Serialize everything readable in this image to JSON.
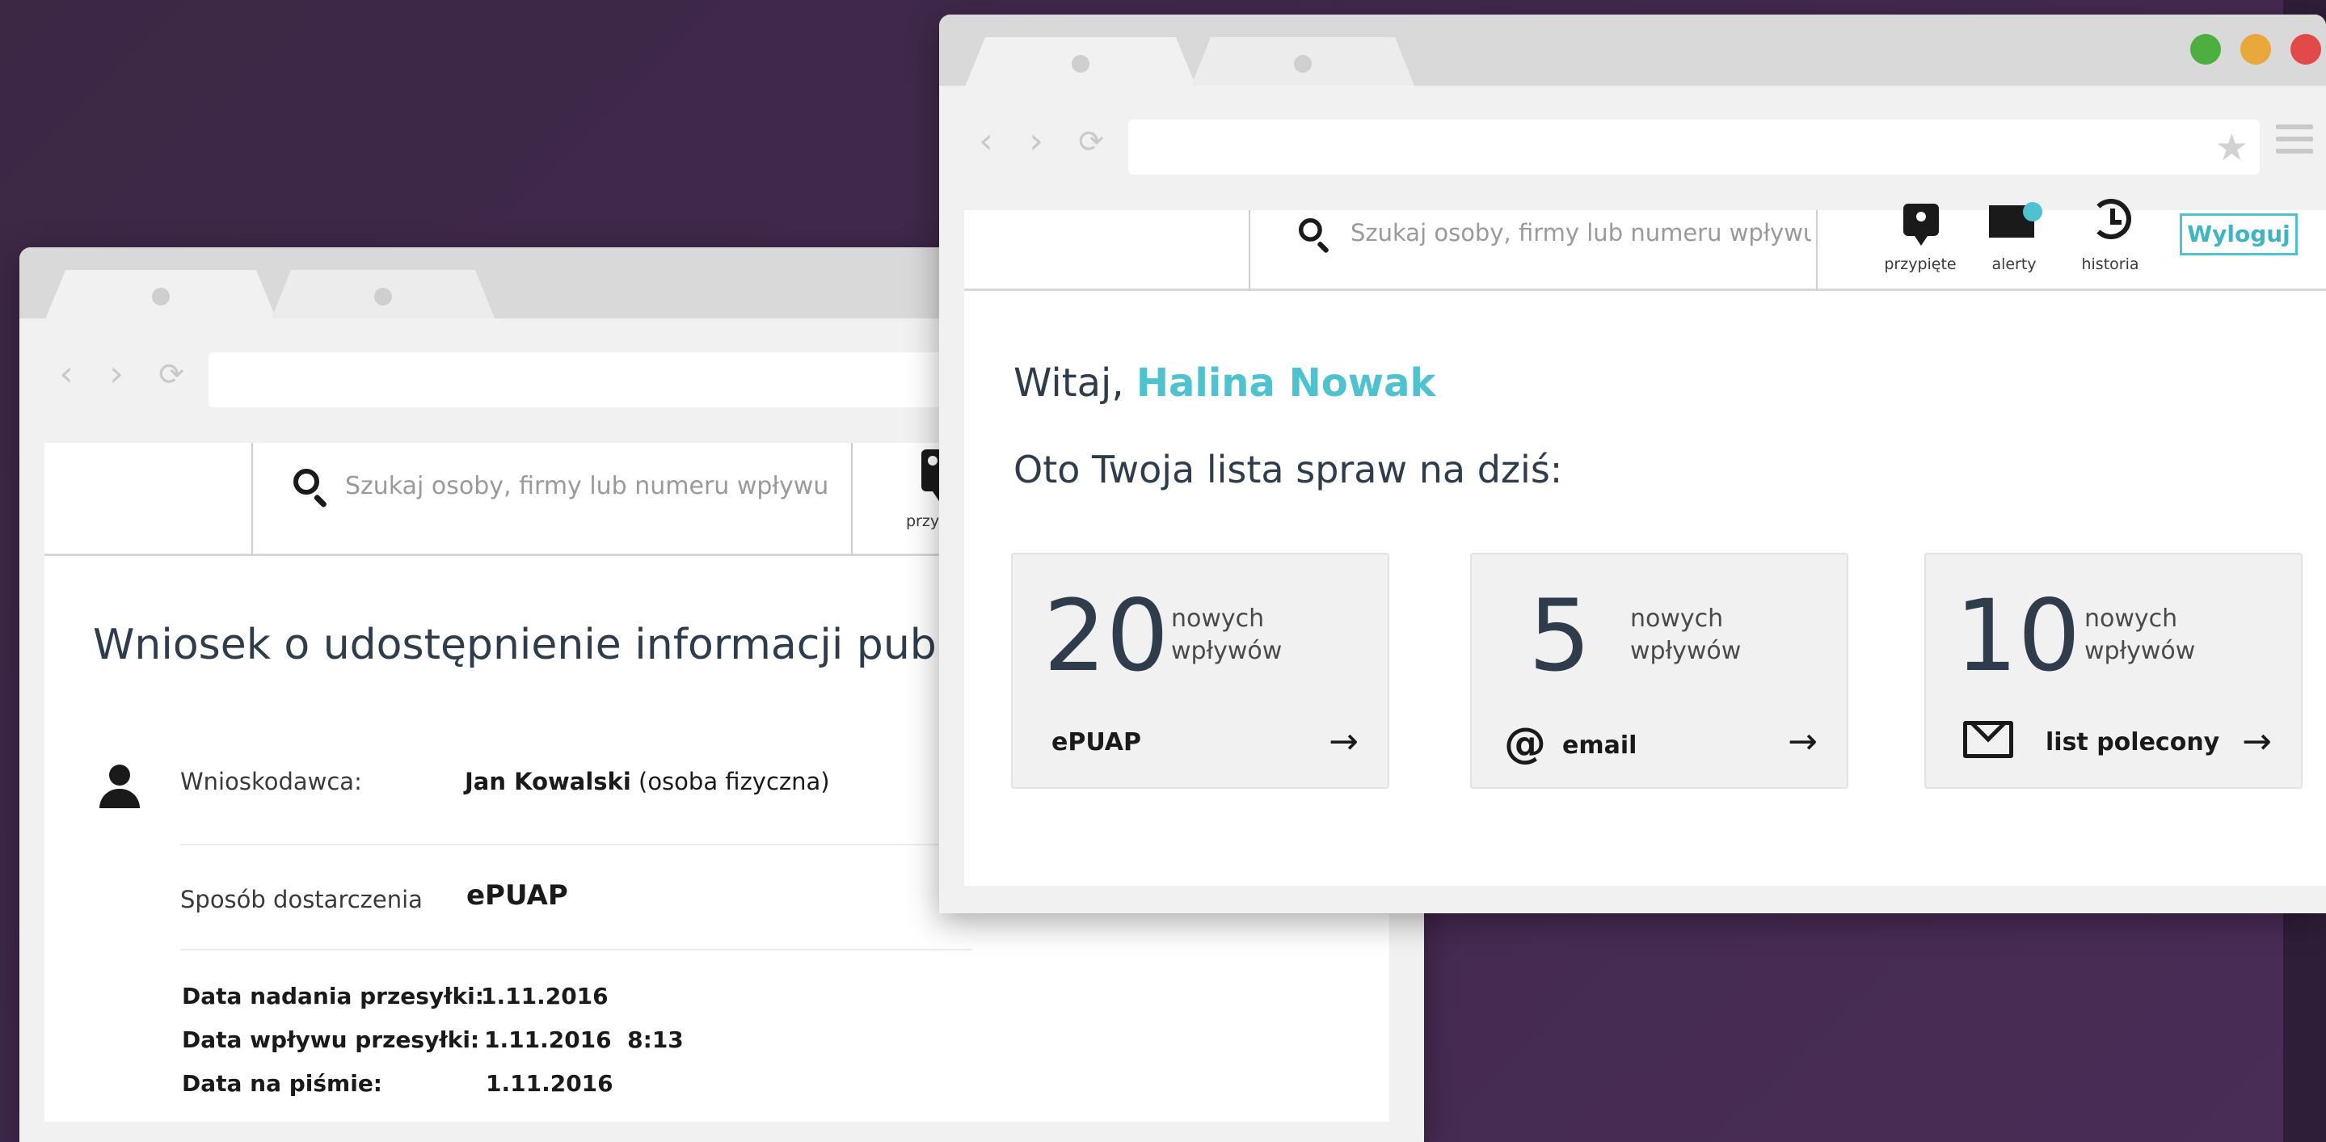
{
  "back_window": {
    "search": {
      "placeholder": "Szukaj osoby, firmy lub numeru wpływu"
    },
    "header_partial_label": "przy",
    "document": {
      "title": "Wniosek o udostępnienie informacji publicznej",
      "applicant": {
        "label": "Wnioskodawca:",
        "name": "Jan Kowalski",
        "type": " (osoba fizyczna)"
      },
      "delivery": {
        "label": "Sposób dostarczenia",
        "value": "ePUAP"
      },
      "dates": [
        {
          "label": "Data nadania przesyłki:",
          "value": "1.11.2016"
        },
        {
          "label": "Data wpływu przesyłki:",
          "value": "1.11.2016  8:13"
        },
        {
          "label": "Data na piśmie:",
          "value": "1.11.2016"
        }
      ]
    }
  },
  "front_window": {
    "search": {
      "placeholder": "Szukaj osoby, firmy lub numeru wpływu"
    },
    "header_actions": [
      {
        "label": "przypięte",
        "icon": "pin-icon"
      },
      {
        "label": "alerty",
        "icon": "envelope-icon"
      },
      {
        "label": "historia",
        "icon": "history-icon"
      }
    ],
    "logout_label": "Wyloguj",
    "greeting_prefix": "Witaj, ",
    "user_name": "Halina Nowak",
    "subtitle": "Oto Twoja lista spraw na dziś:",
    "cards": [
      {
        "count": "20",
        "caption_line1": "nowych",
        "caption_line2": "wpływów",
        "channel": "ePUAP",
        "icon": "none"
      },
      {
        "count": "5",
        "caption_line1": "nowych",
        "caption_line2": "wpływów",
        "channel": "email",
        "icon": "at-icon"
      },
      {
        "count": "10",
        "caption_line1": "nowych",
        "caption_line2": "wpływów",
        "channel": "list polecony",
        "icon": "mail-icon"
      }
    ]
  },
  "colors": {
    "accent": "#4ec3cf",
    "background": "#43294f",
    "traffic_green": "#4caf3f",
    "traffic_yellow": "#e9a93a",
    "traffic_red": "#e24a4a"
  }
}
